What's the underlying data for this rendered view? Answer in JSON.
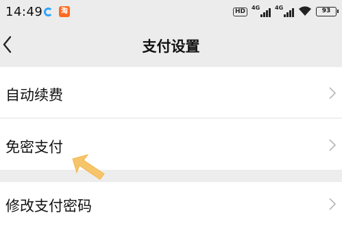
{
  "status_bar": {
    "time": "14:49",
    "hd_label": "HD",
    "network_1": "4G",
    "network_2": "4G",
    "battery": "93",
    "app_icon_2_text": "淘"
  },
  "nav": {
    "title": "支付设置"
  },
  "settings": {
    "items": [
      {
        "label": "自动续费"
      },
      {
        "label": "免密支付"
      },
      {
        "label": "修改支付密码"
      }
    ]
  },
  "colors": {
    "background": "#ededed",
    "row_background": "#ffffff",
    "arrow_hint": "#f6c56a",
    "chevron": "#b5b5b5"
  }
}
